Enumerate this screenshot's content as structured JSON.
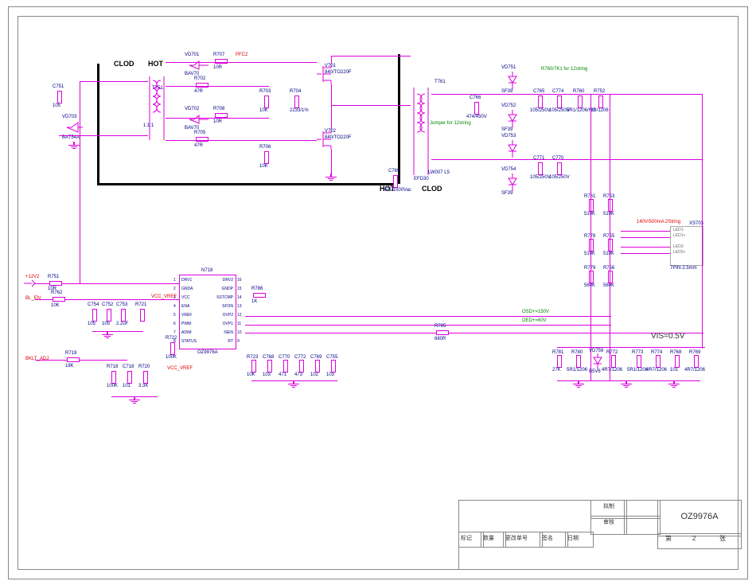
{
  "sheet": {
    "border_outer": true,
    "title_main": "OZ9976A",
    "page_label_left": "第",
    "page_number": "2",
    "page_label_right": "张"
  },
  "titleblock": {
    "col_headers": [
      "标记",
      "数量",
      "更改单号",
      "签名",
      "日期"
    ],
    "row1_label": "拟制",
    "row1_value": "",
    "row2_label": "审核",
    "row2_value": ""
  },
  "labels": {
    "clod_left": "CLOD",
    "hot_left": "HOT",
    "hot_bot": "HOT",
    "clod_bot": "CLOD",
    "efd": "EFD30",
    "jumper_note": "Jumper for 12string",
    "rnc_note": "R760/7K1 for 12string",
    "out_note": "140V/500mA 2String",
    "vis": "VIS=0.5V",
    "conn_footprint": "7PIN-2.5mm",
    "rail1": "OSD+=150V",
    "rail2": "OED+=60V",
    "pfc": "PFC2",
    "v12": "+12V2",
    "bl_en": "BL_EN",
    "bklt": "BKLT_ADJ",
    "vcc_vref1": "VCC_VREF",
    "vcc_vref2": "VCC_VREF"
  },
  "ic": {
    "ref": "N718",
    "part": "OZ9976A",
    "pins_left": [
      "DRV1",
      "GNDA",
      "VCC",
      "ENA",
      "VREF",
      "PWM",
      "ADIM",
      "STATUS"
    ],
    "pins_right": [
      "DRV2",
      "GNDP",
      "SSTCMP",
      "SFON",
      "OVP2",
      "OVP1",
      "ISEN",
      "RT"
    ],
    "nums_left": [
      "1",
      "2",
      "3",
      "4",
      "5",
      "6",
      "7",
      "8"
    ],
    "nums_right": [
      "16",
      "15",
      "14",
      "13",
      "12",
      "11",
      "10",
      "9"
    ]
  },
  "connector": {
    "ref": "XS703",
    "pins": [
      "LED1-",
      "LED1+",
      "",
      "LED2-",
      "LED2+",
      "",
      ""
    ]
  },
  "components": {
    "C751": "105",
    "VD703": "BA754A",
    "T751": "1:1:1",
    "VD701": "BAV70",
    "R707": "10R",
    "VD702": "BAV70",
    "R708": "10R",
    "R702": "47R",
    "R705": "47R",
    "R703": "10K",
    "R706": "10K",
    "V701": "840/TO220F",
    "V702": "840/TO220F",
    "R704": "2233/1%",
    "C769": "471/1000Vac",
    "T761": "",
    "LW007": "L5",
    "C766": "474/450V",
    "VD751": "SF39",
    "VD752": "SF39",
    "VD753": "",
    "VD754": "SF39",
    "C765": "105/250V",
    "C774": "105/250V",
    "R760": "5R1/1206/NC",
    "R752": "0R/1206",
    "C771": "105/250V",
    "C770": "105/250V",
    "R761": "510K",
    "R753": "510K",
    "R778": "510K",
    "R755": "510K",
    "R779": "560K",
    "R756": "560K",
    "R751": "10R",
    "R762": "10K",
    "C754": "105",
    "C752": "105",
    "C753": "2.2uF",
    "R721": "",
    "R722": "100K",
    "R719": "18K",
    "R718": "100K",
    "C718": "101",
    "R720": "3.3K",
    "R786": "1K",
    "R785": "680R",
    "R723": "10K",
    "C768": "103",
    "C770b": "471",
    "C772": "473",
    "C769b": "102",
    "C755": "103",
    "R781": "27K",
    "R780": "5R1/1206",
    "VD759": "B5V6",
    "R772": "4R7/1206",
    "R773": "5R1/1206",
    "R774": "4R7/1206",
    "R768": "101",
    "R769": "4R7/1206"
  },
  "chart_data": {
    "type": "schematic",
    "ic_main": "OZ9976A",
    "power_input": "+12V2",
    "control_inputs": [
      "BL_EN",
      "BKLT_ADJ"
    ],
    "output_connector": "XS703 7PIN-2.5mm",
    "output_spec": "140V/500mA 2String",
    "sense_voltage": "VIS=0.5V",
    "mosfets": [
      "V701 840/TO220F",
      "V702 840/TO220F"
    ],
    "transformers": [
      "T751 1:1:1",
      "T761 EFD30"
    ]
  }
}
